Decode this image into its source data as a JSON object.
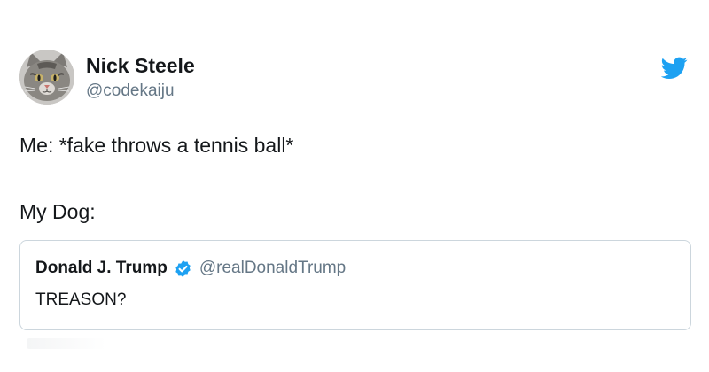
{
  "tweet": {
    "author": {
      "display_name": "Nick Steele",
      "handle": "@codekaiju",
      "avatar_icon": "cat-avatar"
    },
    "brand_icon": "twitter-bird-icon",
    "brand_color": "#1da1f2",
    "lines": [
      "Me: *fake throws a tennis ball*",
      "My Dog:"
    ],
    "quoted": {
      "display_name": "Donald J. Trump",
      "verified_icon": "verified-badge-icon",
      "handle": "@realDonaldTrump",
      "text": "TREASON?"
    }
  }
}
